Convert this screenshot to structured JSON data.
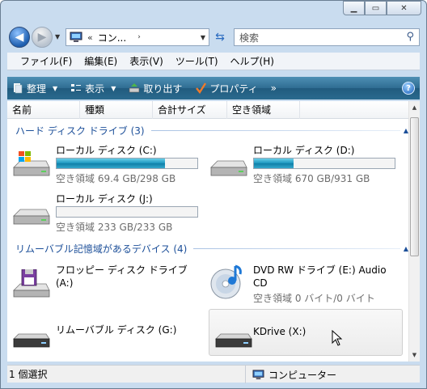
{
  "address": {
    "chevrons": "«",
    "crumb": "コン...",
    "separator": "›"
  },
  "search": {
    "placeholder": "検索"
  },
  "menu": {
    "items": [
      "ファイル(F)",
      "編集(E)",
      "表示(V)",
      "ツール(T)",
      "ヘルプ(H)"
    ]
  },
  "toolbar": {
    "organize": "整理",
    "views": "表示",
    "eject": "取り出す",
    "properties": "プロパティ",
    "more": "»",
    "help": "?"
  },
  "columns": [
    "名前",
    "種類",
    "合計サイズ",
    "空き領域"
  ],
  "groups": {
    "hdd": "ハード ディスク ドライブ (3)",
    "removable": "リムーバブル記憶域があるデバイス (4)"
  },
  "drives": {
    "c": {
      "name": "ローカル ディスク (C:)",
      "free": "空き領域 69.4 GB/298 GB",
      "used_fraction": 0.77
    },
    "d": {
      "name": "ローカル ディスク (D:)",
      "free": "空き領域 670 GB/931 GB",
      "used_fraction": 0.28
    },
    "j": {
      "name": "ローカル ディスク (J:)",
      "free": "空き領域 233 GB/233 GB",
      "used_fraction": 0.0
    },
    "a": {
      "name": "フロッピー ディスク ドライブ",
      "name2": "(A:)"
    },
    "e": {
      "name": "DVD RW ドライブ (E:) Audio",
      "name2": "CD",
      "free": "空き領域 0 バイト/0 バイト"
    },
    "g": {
      "name": "リムーバブル ディスク (G:)"
    },
    "x": {
      "name": "KDrive (X:)"
    }
  },
  "status": {
    "selection": "1 個選択",
    "location": "コンピューター"
  },
  "colors": {
    "toolbar": "#2f6d92",
    "group_title": "#1c4f99",
    "bar_fill": "#1a94bd"
  }
}
